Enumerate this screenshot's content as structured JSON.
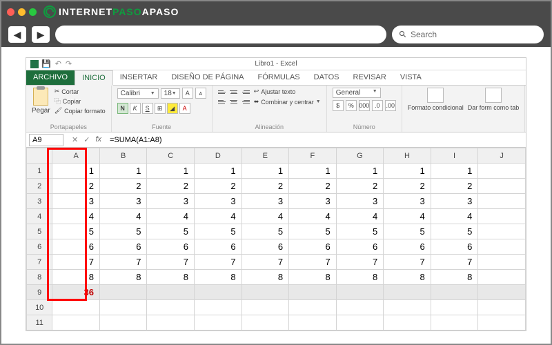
{
  "browser": {
    "logo_a": "INTERNET",
    "logo_b": "PASO",
    "logo_c": "APASO",
    "search_placeholder": "Search"
  },
  "excel": {
    "title": "Libro1 - Excel",
    "tabs": {
      "file": "ARCHIVO",
      "home": "INICIO",
      "insert": "INSERTAR",
      "layout": "DISEÑO DE PÁGINA",
      "formulas": "FÓRMULAS",
      "data": "DATOS",
      "review": "REVISAR",
      "view": "VISTA"
    },
    "ribbon": {
      "paste": "Pegar",
      "cut": "Cortar",
      "copy": "Copiar",
      "format_painter": "Copiar formato",
      "clipboard": "Portapapeles",
      "font_name": "Calibri",
      "font_size": "18",
      "font_group": "Fuente",
      "wrap": "Ajustar texto",
      "merge": "Combinar y centrar",
      "align_group": "Alineación",
      "number_format": "General",
      "number_group": "Número",
      "cond_format": "Formato condicional",
      "as_table": "Dar form como tab"
    },
    "namebox": "A9",
    "formula": "=SUMA(A1:A8)",
    "cols": [
      "A",
      "B",
      "C",
      "D",
      "E",
      "F",
      "G",
      "H",
      "I",
      "J"
    ],
    "rows": [
      {
        "n": "1",
        "v": [
          "1",
          "1",
          "1",
          "1",
          "1",
          "1",
          "1",
          "1",
          "1",
          ""
        ]
      },
      {
        "n": "2",
        "v": [
          "2",
          "2",
          "2",
          "2",
          "2",
          "2",
          "2",
          "2",
          "2",
          ""
        ]
      },
      {
        "n": "3",
        "v": [
          "3",
          "3",
          "3",
          "3",
          "3",
          "3",
          "3",
          "3",
          "3",
          ""
        ]
      },
      {
        "n": "4",
        "v": [
          "4",
          "4",
          "4",
          "4",
          "4",
          "4",
          "4",
          "4",
          "4",
          ""
        ]
      },
      {
        "n": "5",
        "v": [
          "5",
          "5",
          "5",
          "5",
          "5",
          "5",
          "5",
          "5",
          "5",
          ""
        ]
      },
      {
        "n": "6",
        "v": [
          "6",
          "6",
          "6",
          "6",
          "6",
          "6",
          "6",
          "6",
          "6",
          ""
        ]
      },
      {
        "n": "7",
        "v": [
          "7",
          "7",
          "7",
          "7",
          "7",
          "7",
          "7",
          "7",
          "7",
          ""
        ]
      },
      {
        "n": "8",
        "v": [
          "8",
          "8",
          "8",
          "8",
          "8",
          "8",
          "8",
          "8",
          "8",
          ""
        ]
      },
      {
        "n": "9",
        "v": [
          "36",
          "",
          "",
          "",
          "",
          "",
          "",
          "",
          "",
          ""
        ]
      },
      {
        "n": "10",
        "v": [
          "",
          "",
          "",
          "",
          "",
          "",
          "",
          "",
          "",
          ""
        ]
      },
      {
        "n": "11",
        "v": [
          "",
          "",
          "",
          "",
          "",
          "",
          "",
          "",
          "",
          ""
        ]
      }
    ]
  }
}
